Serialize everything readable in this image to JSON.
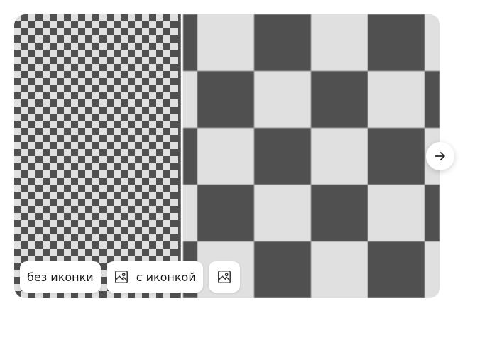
{
  "gallery": {
    "next_icon": "arrow-right-icon",
    "chips": [
      {
        "label": "без иконки",
        "icon": ""
      },
      {
        "label": "с иконкой",
        "icon": "image-icon"
      },
      {
        "label": "",
        "icon": "image-icon"
      }
    ]
  },
  "colors": {
    "checker_dark": "#505050",
    "checker_light": "#e0e0e0",
    "chip_bg": "#ffffff",
    "text": "#1a1a1a"
  }
}
